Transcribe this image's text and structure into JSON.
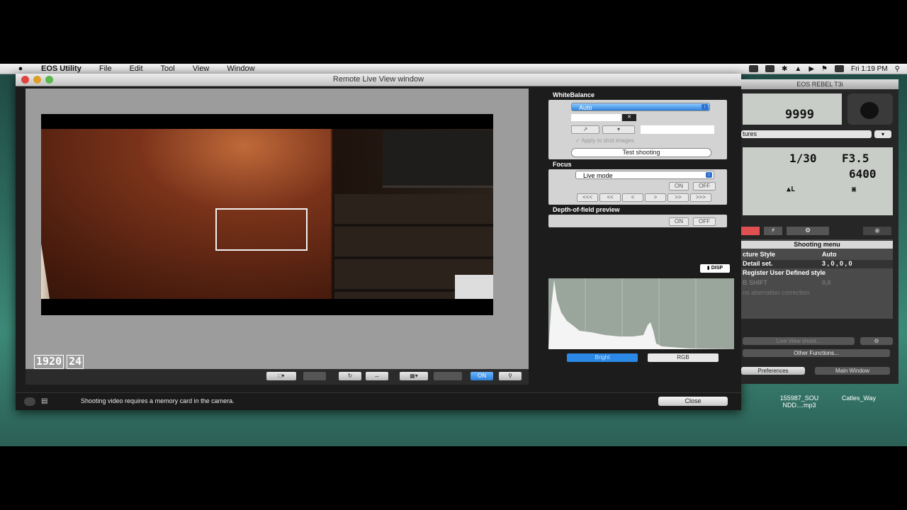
{
  "menubar": {
    "apple": "",
    "items": [
      "EOS Utility",
      "File",
      "Edit",
      "Tool",
      "View",
      "Window"
    ],
    "clock": "Fri 1:19 PM"
  },
  "window": {
    "title": "Remote Live View window",
    "rec_badge": [
      "1920",
      "24"
    ],
    "toolbar": {
      "on_label": "ON"
    },
    "status_message": "Shooting video requires a memory card in the camera.",
    "close_label": "Close"
  },
  "controls": {
    "white_balance": {
      "heading": "WhiteBalance",
      "selected": "Auto",
      "apply_label": "Apply to shot images",
      "test_label": "Test shooting"
    },
    "focus": {
      "heading": "Focus",
      "selected": "Live mode",
      "on": "ON",
      "off": "OFF",
      "steps": [
        "<<<",
        "<<",
        "<",
        ">",
        ">>",
        ">>>"
      ]
    },
    "dof": {
      "heading": "Depth-of-field preview",
      "on": "ON",
      "off": "OFF"
    },
    "disp_label": "DISP",
    "histogram": {
      "bright": "Bright",
      "rgb": "RGB"
    }
  },
  "camera": {
    "title": "EOS REBEL T3i",
    "shots": "9999",
    "mode": "tures",
    "shutter": "1/30",
    "aperture": "F3.5",
    "iso": "6400",
    "menu_title": "Shooting menu",
    "rows": [
      {
        "k": "cture Style",
        "v": "Auto"
      },
      {
        "k": "Detail set.",
        "v": "3 , 0 , 0 , 0"
      },
      {
        "k": "Register User Defined style",
        "v": ""
      },
      {
        "k": "B SHIFT",
        "v": "0,0"
      },
      {
        "k": "ns aberration correction",
        "v": ""
      }
    ],
    "live_view_label": "Live View shoot...",
    "other_functions": "Other Functions...",
    "preferences": "Preferences",
    "main_window": "Main Window"
  },
  "desktop": {
    "file1": "155987_SOUNDD...mp3",
    "file1_l1": "155987_SOU",
    "file1_l2": "NDD....mp3",
    "file2": "Catles_Way"
  }
}
